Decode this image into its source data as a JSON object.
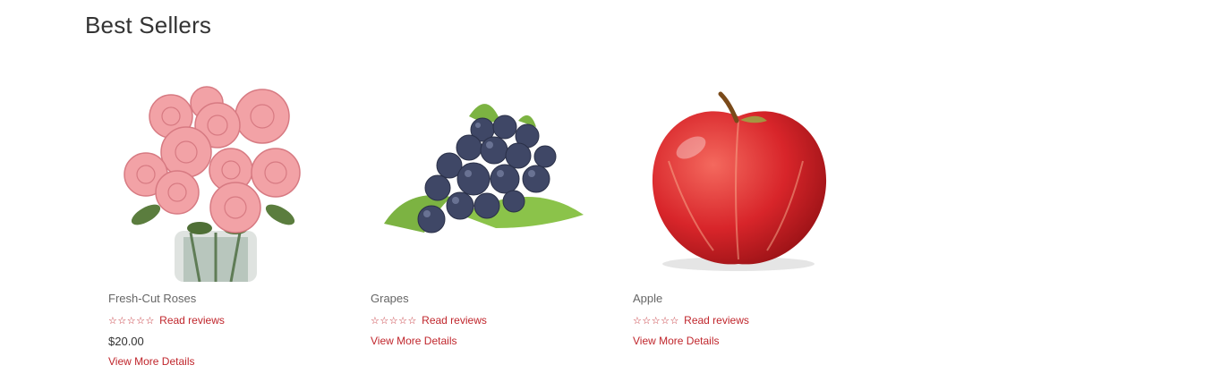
{
  "section": {
    "title": "Best Sellers"
  },
  "products": [
    {
      "name": "Fresh-Cut Roses",
      "image": "roses-bouquet",
      "stars": "☆☆☆☆☆",
      "reviews_label": "Read reviews",
      "price": "$20.00",
      "details_label": "View More Details"
    },
    {
      "name": "Grapes",
      "image": "grapes-bunch",
      "stars": "☆☆☆☆☆",
      "reviews_label": "Read reviews",
      "details_label": "View More Details"
    },
    {
      "name": "Apple",
      "image": "red-apple",
      "stars": "☆☆☆☆☆",
      "reviews_label": "Read reviews",
      "details_label": "View More Details"
    }
  ],
  "colors": {
    "link": "#c0262c",
    "title": "#333333",
    "name": "#666666"
  }
}
